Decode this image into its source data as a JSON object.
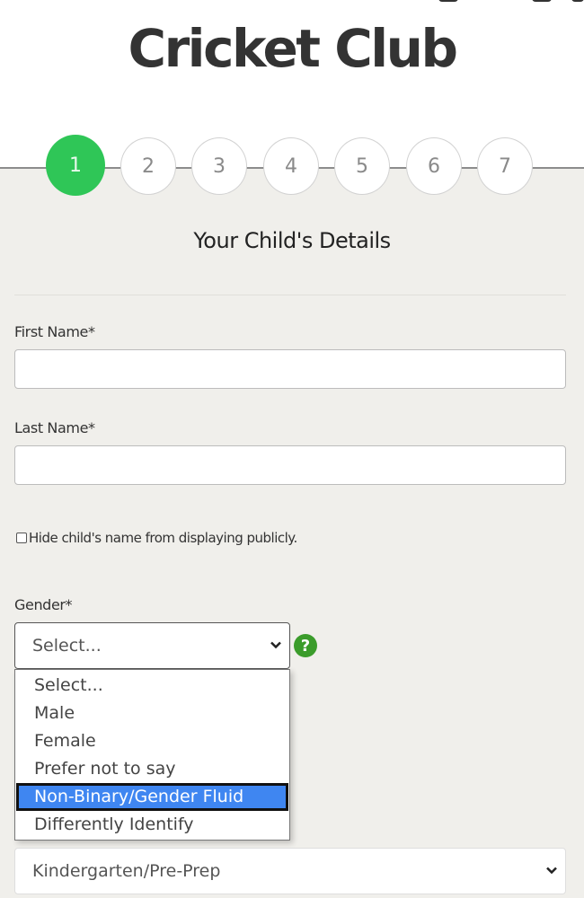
{
  "header": {
    "club_title": "Cricket Club"
  },
  "stepper": {
    "steps": [
      "1",
      "2",
      "3",
      "4",
      "5",
      "6",
      "7"
    ],
    "current_step": 1
  },
  "form": {
    "section_title": "Your Child's Details",
    "first_name": {
      "label": "First Name*",
      "value": ""
    },
    "last_name": {
      "label": "Last Name*",
      "value": ""
    },
    "hide_name_checkbox": {
      "label": "Hide child's name from displaying publicly.",
      "checked": false
    },
    "gender": {
      "label": "Gender*",
      "selected": "Select...",
      "help_icon": "?",
      "options": [
        "Select...",
        "Male",
        "Female",
        "Prefer not to say",
        "Non-Binary/Gender Fluid",
        "Differently Identify"
      ],
      "highlighted_option": "Non-Binary/Gender Fluid"
    },
    "school_year": {
      "selected": "Kindergarten/Pre-Prep"
    }
  },
  "colors": {
    "active_step": "#2fc657",
    "help_icon": "#3b9c2b",
    "highlight": "#3f86f1",
    "panel_bg": "#f0efeb",
    "title_text": "#333333"
  }
}
